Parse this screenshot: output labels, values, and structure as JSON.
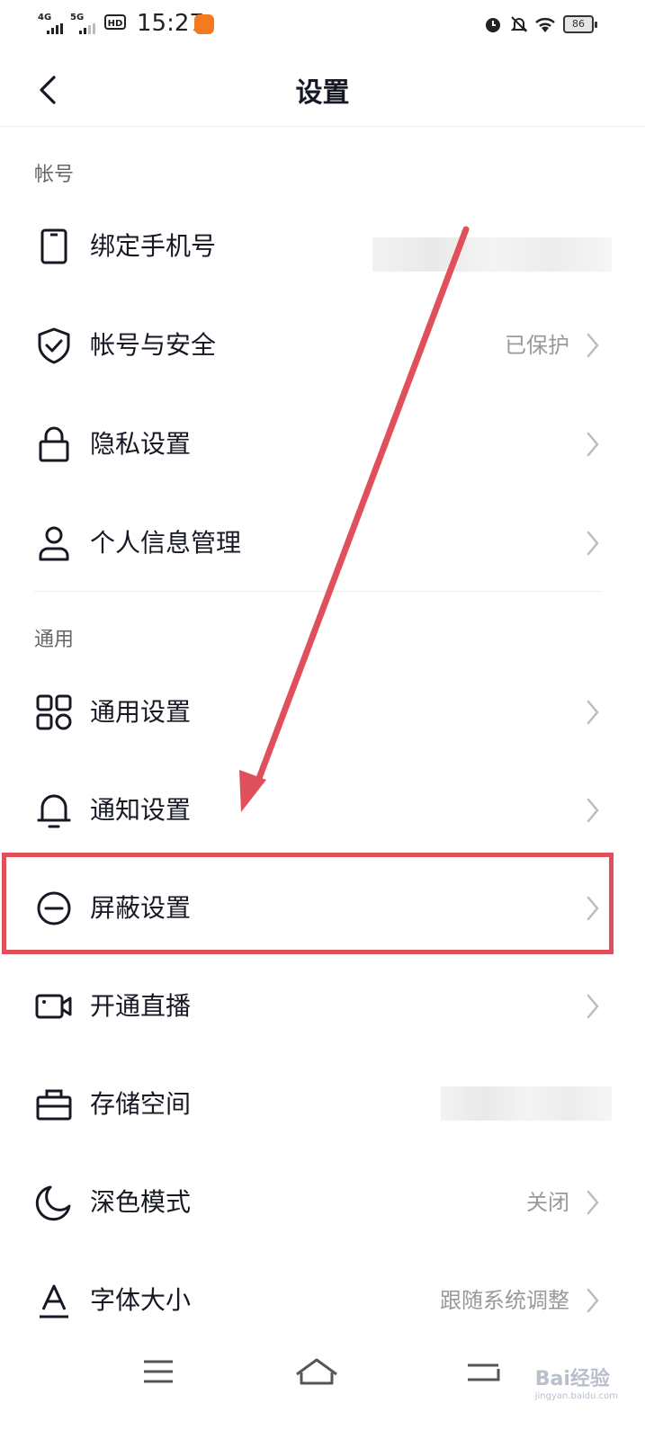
{
  "status_bar": {
    "signal1": "4G",
    "signal2": "5G",
    "hd": "HD",
    "time": "15:27",
    "battery": "86"
  },
  "header": {
    "title": "设置"
  },
  "sections": {
    "account": "帐号",
    "general": "通用"
  },
  "account_items": [
    {
      "label": "绑定手机号",
      "value": ""
    },
    {
      "label": "帐号与安全",
      "value": "已保护"
    },
    {
      "label": "隐私设置",
      "value": ""
    },
    {
      "label": "个人信息管理",
      "value": ""
    }
  ],
  "general_items": [
    {
      "label": "通用设置",
      "value": ""
    },
    {
      "label": "通知设置",
      "value": ""
    },
    {
      "label": "屏蔽设置",
      "value": ""
    },
    {
      "label": "开通直播",
      "value": ""
    },
    {
      "label": "存储空间",
      "value": ""
    },
    {
      "label": "深色模式",
      "value": "关闭"
    },
    {
      "label": "字体大小",
      "value": "跟随系统调整"
    }
  ],
  "annotation": {
    "highlight_color": "#e0505b"
  },
  "watermark": {
    "brand": "Bai经验",
    "url": "jingyan.baidu.com"
  }
}
